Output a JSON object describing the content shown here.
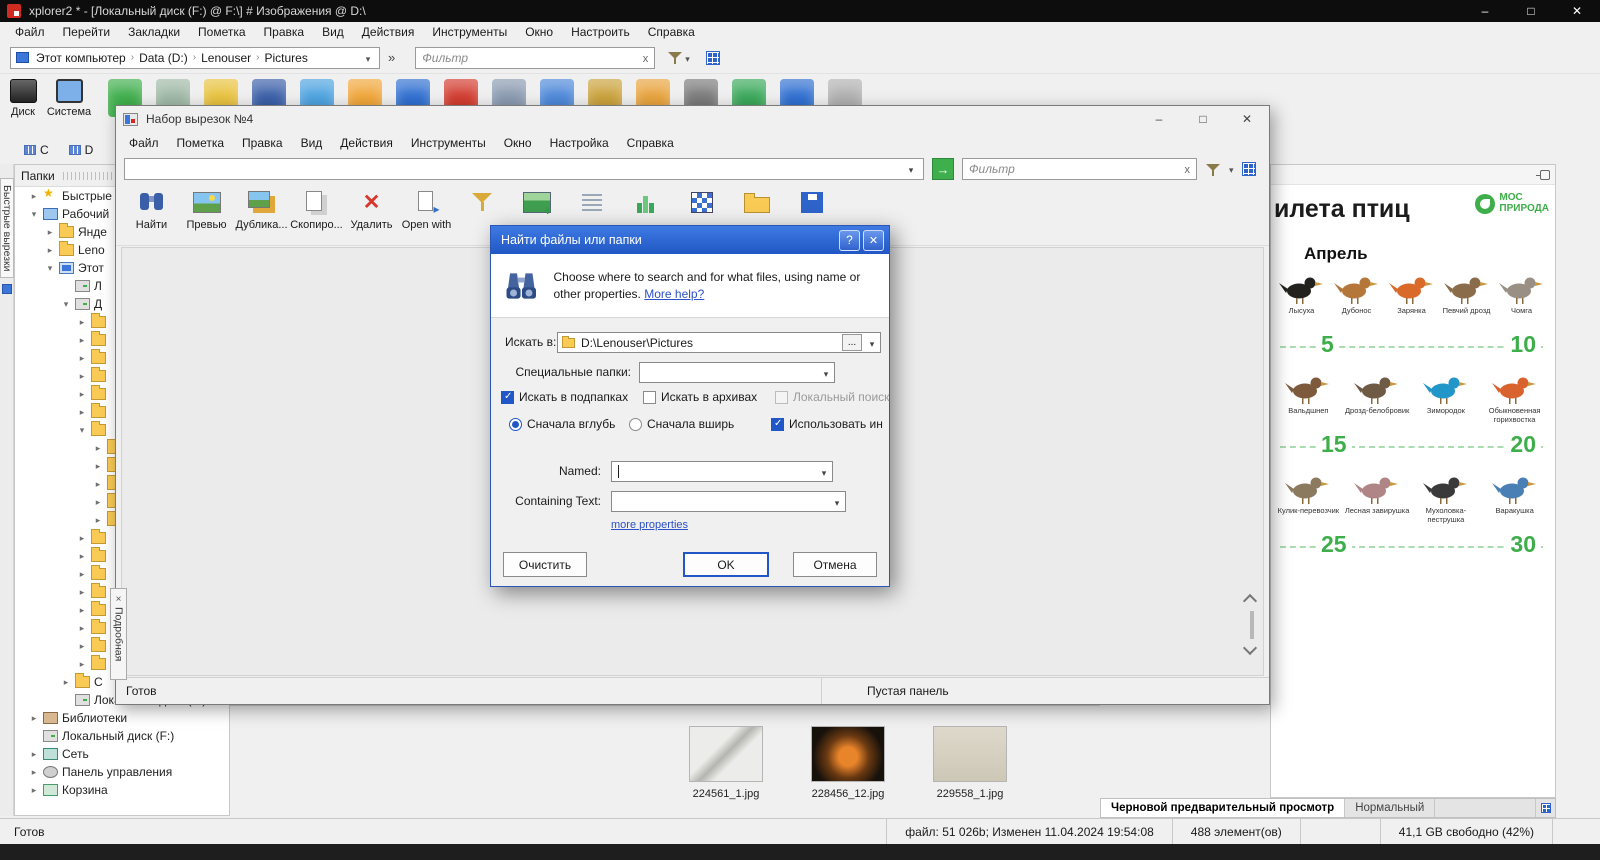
{
  "main": {
    "title": "xplorer2 * - [Локальный диск (F:) @ F:\\] # Изображения @ D:\\",
    "menu": [
      "Файл",
      "Перейти",
      "Закладки",
      "Пометка",
      "Правка",
      "Вид",
      "Действия",
      "Инструменты",
      "Окно",
      "Настроить",
      "Справка"
    ],
    "breadcrumb": [
      {
        "label": "Этот компьютер",
        "sep": "›"
      },
      {
        "label": "Data (D:)",
        "sep": "›"
      },
      {
        "label": "Lenouser",
        "sep": "›"
      },
      {
        "label": "Pictures",
        "sep": ""
      }
    ],
    "filter_placeholder": "Фильтр",
    "big_buttons": [
      {
        "label": "Диск",
        "icon": "disk"
      },
      {
        "label": "Система",
        "icon": "system"
      }
    ],
    "toolbar_colors": [
      {
        "c": "#3fae4c"
      },
      {
        "c": "#9fb8a6"
      },
      {
        "c": "#e8c23e"
      },
      {
        "c": "#3a5fa8"
      },
      {
        "c": "#4da3e0"
      },
      {
        "c": "#f0a63a"
      },
      {
        "c": "#2f6fd0"
      },
      {
        "c": "#d23b2f"
      },
      {
        "c": "#8a9ab0"
      },
      {
        "c": "#4d88d9"
      },
      {
        "c": "#caa23c"
      },
      {
        "c": "#e8a33d"
      },
      {
        "c": "#7a7a7a"
      },
      {
        "c": "#3aa85a"
      },
      {
        "c": "#2f6fd0"
      },
      {
        "c": "#b0b0b0"
      }
    ],
    "drive_tabs": [
      {
        "label": "C"
      },
      {
        "label": "D"
      }
    ],
    "tree_title": "Папки",
    "quick_strip_label": "Быстрые вырезки",
    "detail_tab_label": "Подробная",
    "tree": [
      {
        "arrow": "▸",
        "icon": "star",
        "label": "Быстрые",
        "indent": 14
      },
      {
        "arrow": "▾",
        "icon": "desktop",
        "label": "Рабочий",
        "indent": 14
      },
      {
        "arrow": "▸",
        "icon": "folder",
        "label": "Янде",
        "indent": 30
      },
      {
        "arrow": "▸",
        "icon": "folder",
        "label": "Leno",
        "indent": 30
      },
      {
        "arrow": "▾",
        "icon": "computer",
        "label": "Этот",
        "indent": 30
      },
      {
        "arrow": "",
        "icon": "drive",
        "label": "Л",
        "indent": 46
      },
      {
        "arrow": "▾",
        "icon": "drive",
        "label": "Д",
        "indent": 46
      },
      {
        "arrow": "▸",
        "icon": "folder",
        "label": "",
        "indent": 62
      },
      {
        "arrow": "▸",
        "icon": "folder",
        "label": "",
        "indent": 62
      },
      {
        "arrow": "▸",
        "icon": "folder",
        "label": "",
        "indent": 62
      },
      {
        "arrow": "▸",
        "icon": "folder",
        "label": "",
        "indent": 62
      },
      {
        "arrow": "▸",
        "icon": "folder",
        "label": "",
        "indent": 62
      },
      {
        "arrow": "▸",
        "icon": "folder",
        "label": "",
        "indent": 62
      },
      {
        "arrow": "▾",
        "icon": "folder",
        "label": "",
        "indent": 62
      },
      {
        "arrow": "▸",
        "icon": "folder",
        "label": "",
        "indent": 78
      },
      {
        "arrow": "▸",
        "icon": "folder",
        "label": "",
        "indent": 78
      },
      {
        "arrow": "▸",
        "icon": "folder",
        "label": "",
        "indent": 78
      },
      {
        "arrow": "▸",
        "icon": "folder",
        "label": "",
        "indent": 78
      },
      {
        "arrow": "▸",
        "icon": "folder",
        "label": "",
        "indent": 78
      },
      {
        "arrow": "▸",
        "icon": "folder",
        "label": "",
        "indent": 62
      },
      {
        "arrow": "▸",
        "icon": "folder",
        "label": "",
        "indent": 62
      },
      {
        "arrow": "▸",
        "icon": "folder",
        "label": "",
        "indent": 62
      },
      {
        "arrow": "▸",
        "icon": "folder",
        "label": "",
        "indent": 62
      },
      {
        "arrow": "▸",
        "icon": "folder",
        "label": "",
        "indent": 62
      },
      {
        "arrow": "▸",
        "icon": "folder",
        "label": "",
        "indent": 62
      },
      {
        "arrow": "▸",
        "icon": "folder",
        "label": "",
        "indent": 62
      },
      {
        "arrow": "▸",
        "icon": "folder",
        "label": "",
        "indent": 62
      },
      {
        "arrow": "▸",
        "icon": "folder",
        "label": "С",
        "indent": 46
      },
      {
        "arrow": "",
        "icon": "drive",
        "label": "Локальный диск (F:)",
        "indent": 46
      },
      {
        "arrow": "▸",
        "icon": "library",
        "label": "Библиотеки",
        "indent": 14
      },
      {
        "arrow": "",
        "icon": "drive",
        "label": "Локальный диск (F:)",
        "indent": 14
      },
      {
        "arrow": "▸",
        "icon": "network",
        "label": "Сеть",
        "indent": 14
      },
      {
        "arrow": "▸",
        "icon": "panel",
        "label": "Панель управления",
        "indent": 14
      },
      {
        "arrow": "▸",
        "icon": "recycle",
        "label": "Корзина",
        "indent": 14
      }
    ],
    "thumbnails": [
      {
        "name": "224561_1.jpg",
        "look": "ta"
      },
      {
        "name": "228456_12.jpg",
        "look": "tb"
      },
      {
        "name": "229558_1.jpg",
        "look": "tc"
      }
    ],
    "preview_tabs": [
      {
        "label": "Черновой предварительный просмотр",
        "active": true
      },
      {
        "label": "Нормальный",
        "active": false
      }
    ],
    "status": {
      "ready": "Готов",
      "file_info": "файл: 51 026b; Изменен 11.04.2024 19:54:08",
      "items_count": "488 элемент(ов)",
      "free_space": "41,1 GB свободно (42%)"
    }
  },
  "child": {
    "title": "Набор вырезок №4",
    "menu": [
      "Файл",
      "Пометка",
      "Правка",
      "Вид",
      "Действия",
      "Инструменты",
      "Окно",
      "Настройка",
      "Справка"
    ],
    "filter_placeholder": "Фильтр",
    "toolbar": [
      {
        "label": "Найти",
        "icon": "find"
      },
      {
        "label": "Превью",
        "icon": "pic"
      },
      {
        "label": "Дублика...",
        "icon": "pics"
      },
      {
        "label": "Скопиро...",
        "icon": "copy"
      },
      {
        "label": "Удалить",
        "icon": "del"
      },
      {
        "label": "Open with",
        "icon": "open"
      },
      {
        "label": "",
        "icon": "funnel"
      },
      {
        "label": "",
        "icon": "picgreen"
      },
      {
        "label": "",
        "icon": "list"
      },
      {
        "label": "",
        "icon": "chart"
      },
      {
        "label": "",
        "icon": "checker"
      },
      {
        "label": "",
        "icon": "folderop"
      },
      {
        "label": "",
        "icon": "save"
      }
    ],
    "status_ready": "Готов",
    "status_panel": "Пустая панель"
  },
  "dialog": {
    "title": "Найти файлы или папки",
    "description": "Choose where to search and for what files, using name or other properties.",
    "help_link": "More help?",
    "look_in_label": "Искать в:",
    "look_in_value": "D:\\Lenouser\\Pictures",
    "browse_button": "...",
    "special_label": "Специальные папки:",
    "check_subfolders": "Искать в подпапках",
    "check_archives": "Искать в архивах",
    "check_local": "Локальный поиск",
    "radio_depth": "Сначала вглубь",
    "radio_breadth": "Сначала вширь",
    "check_index": "Использовать ин",
    "named_label": "Named:",
    "containing_label": "Containing Text:",
    "more_properties": "more properties",
    "clear_button": "Очистить",
    "ok_button": "OK",
    "cancel_button": "Отмена"
  },
  "calendar": {
    "title_visible": "илета птиц",
    "logo_top": "МОС",
    "logo_bottom": "ПРИРОДА",
    "month": "Апрель",
    "accent_green": "#3dae49",
    "rows": [
      {
        "from": "5",
        "to": "10",
        "birds": [
          {
            "name": "Лысуха",
            "color": "#23211e"
          },
          {
            "name": "Дубонос",
            "color": "#b5763a"
          },
          {
            "name": "Зарянка",
            "color": "#d96a2a"
          },
          {
            "name": "Певчий дрозд",
            "color": "#8a6b4a"
          },
          {
            "name": "Чомга",
            "color": "#9a8f85"
          }
        ]
      },
      {
        "from": "15",
        "to": "20",
        "birds": [
          {
            "name": "Вальдшнеп",
            "color": "#7d5a3c"
          },
          {
            "name": "Дрозд-белобровик",
            "color": "#6e5a45"
          },
          {
            "name": "Зимородок",
            "color": "#2196c9"
          },
          {
            "name": "Обыкновенная горихвостка",
            "color": "#d9632e"
          }
        ]
      },
      {
        "from": "25",
        "to": "30",
        "birds": [
          {
            "name": "Кулик-перевозчик",
            "color": "#8c7a5f"
          },
          {
            "name": "Лесная завирушка",
            "color": "#b08585"
          },
          {
            "name": "Мухоловка-пеструшка",
            "color": "#3a3a3a"
          },
          {
            "name": "Варакушка",
            "color": "#4a7fb5"
          }
        ]
      }
    ]
  }
}
